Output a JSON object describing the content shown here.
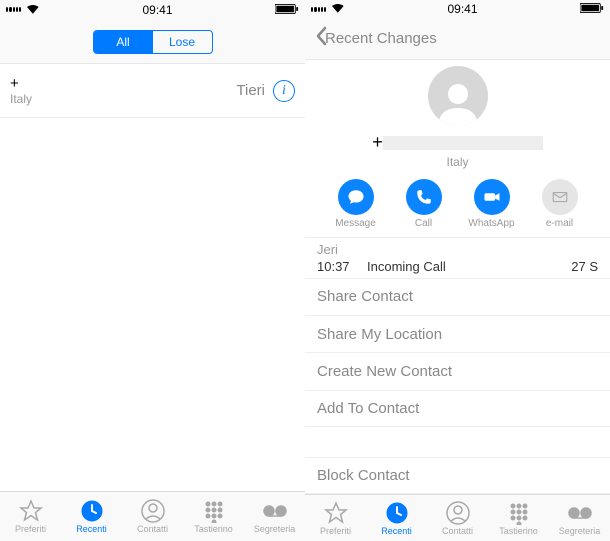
{
  "status": {
    "time": "09:41"
  },
  "left": {
    "segments": {
      "all": "All",
      "lose": "Lose"
    },
    "recent": {
      "number": "+",
      "country": "Italy",
      "time": "Tieri"
    }
  },
  "right": {
    "nav_title": "Recent Changes",
    "phone": "+",
    "country": "Italy",
    "actions": {
      "message": "Message",
      "call": "Call",
      "whatsapp": "WhatsApp",
      "email": "e-mail"
    },
    "log": {
      "title": "Jeri",
      "time": "10:37",
      "type": "Incoming Call",
      "duration": "27 S"
    },
    "options": {
      "share_contact": "Share Contact",
      "share_location": "Share My Location",
      "create_contact": "Create New Contact",
      "add_contact": "Add To Contact",
      "block": "Block Contact"
    }
  },
  "tabs": {
    "favorites": "Preferiti",
    "recents": "Recenti",
    "contacts": "Contatti",
    "keypad": "Tastierino",
    "voicemail": "Segreteria"
  }
}
